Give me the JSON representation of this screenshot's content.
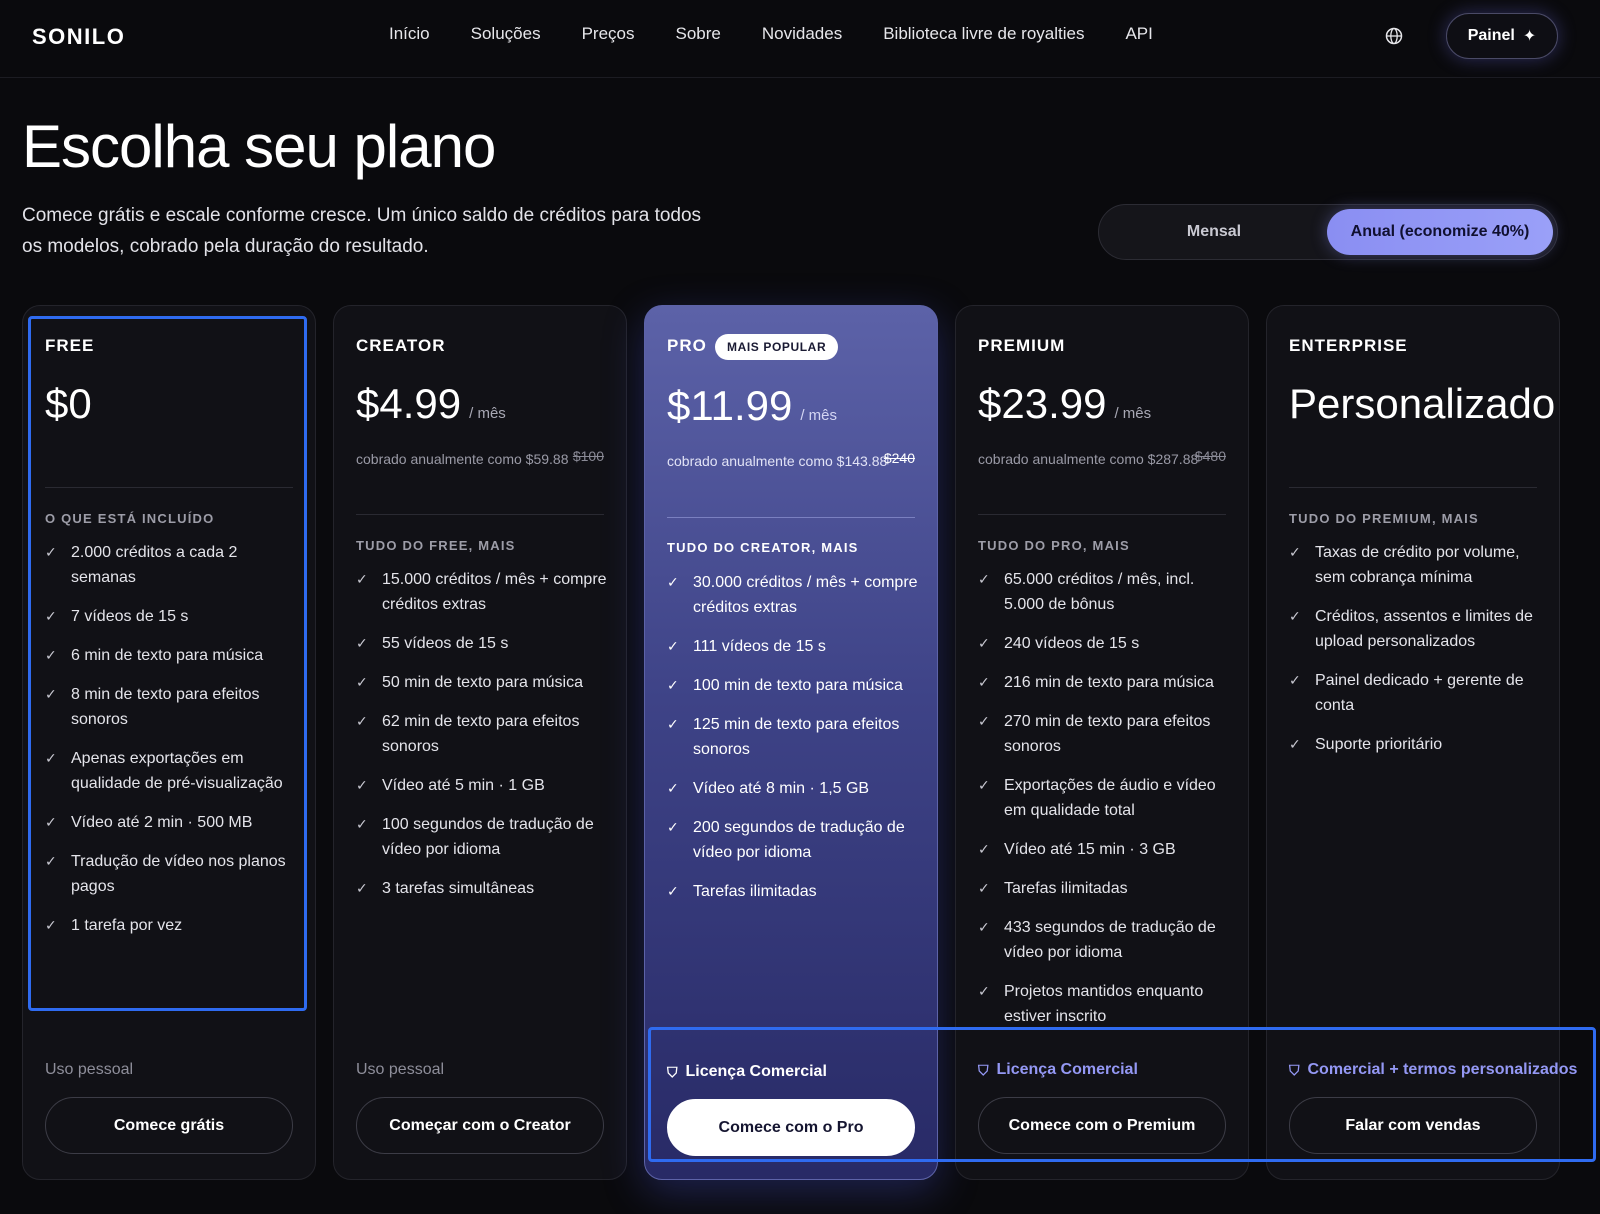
{
  "nav": {
    "logo": "SONILO",
    "links": [
      "Início",
      "Soluções",
      "Preços",
      "Sobre",
      "Novidades",
      "Biblioteca livre de royalties",
      "API"
    ],
    "panel_label": "Painel",
    "panel_icon": "sparkle-icon",
    "language_icon": "globe-icon"
  },
  "header": {
    "title": "Escolha seu plano",
    "subtitle": "Comece grátis e escale conforme cresce. Um único saldo de créditos para todos os modelos, cobrado pela duração do resultado."
  },
  "billing_toggle": {
    "monthly_label": "Mensal",
    "annual_label": "Anual (economize 40%)",
    "selected": "Anual (economize 40%)"
  },
  "plans": [
    {
      "name": "FREE",
      "badge": "",
      "price": "$0",
      "period": "",
      "billed": "",
      "original_price": "",
      "included_heading": "O QUE ESTÁ INCLUÍDO",
      "features": [
        "2.000 créditos a cada 2 semanas",
        "7 vídeos de 15 s",
        "6 min de texto para música",
        "8 min de texto para efeitos sonoros",
        "Apenas exportações em qualidade de pré-visualização",
        "Vídeo até 2 min · 500 MB",
        "Tradução de vídeo nos planos pagos",
        "1 tarefa por vez"
      ],
      "usage": "Uso pessoal",
      "cta": "Comece grátis"
    },
    {
      "name": "CREATOR",
      "badge": "",
      "price": "$4.99",
      "period": "/ mês",
      "billed": "cobrado anualmente como $59.88",
      "original_price": "$100",
      "included_heading": "TUDO DO FREE, MAIS",
      "features": [
        "15.000 créditos / mês + compre créditos extras",
        "55 vídeos de 15 s",
        "50 min de texto para música",
        "62 min de texto para efeitos sonoros",
        "Vídeo até 5 min · 1 GB",
        "100 segundos de tradução de vídeo por idioma",
        "3 tarefas simultâneas"
      ],
      "usage": "Uso pessoal",
      "cta": "Começar com o Creator"
    },
    {
      "name": "PRO",
      "badge": "MAIS POPULAR",
      "price": "$11.99",
      "period": "/ mês",
      "billed": "cobrado anualmente como $143.88",
      "original_price": "$240",
      "included_heading": "TUDO DO CREATOR, MAIS",
      "features": [
        "30.000 créditos / mês + compre créditos extras",
        "111 vídeos de 15 s",
        "100 min de texto para música",
        "125 min de texto para efeitos sonoros",
        "Vídeo até 8 min · 1,5 GB",
        "200 segundos de tradução de vídeo por idioma",
        "Tarefas ilimitadas"
      ],
      "usage": "Licença Comercial",
      "cta": "Comece com o Pro"
    },
    {
      "name": "PREMIUM",
      "badge": "",
      "price": "$23.99",
      "period": "/ mês",
      "billed": "cobrado anualmente como $287.88",
      "original_price": "$480",
      "included_heading": "TUDO DO PRO, MAIS",
      "features": [
        "65.000 créditos / mês, incl. 5.000 de bônus",
        "240 vídeos de 15 s",
        "216 min de texto para música",
        "270 min de texto para efeitos sonoros",
        "Exportações de áudio e vídeo em qualidade total",
        "Vídeo até 15 min · 3 GB",
        "Tarefas ilimitadas",
        "433 segundos de tradução de vídeo por idioma",
        "Projetos mantidos enquanto estiver inscrito"
      ],
      "usage": "Licença Comercial",
      "cta": "Comece com o Premium"
    },
    {
      "name": "ENTERPRISE",
      "badge": "",
      "price": "Personalizado",
      "period": "",
      "billed": "",
      "original_price": "",
      "included_heading": "TUDO DO PREMIUM, MAIS",
      "features": [
        "Taxas de crédito por volume, sem cobrança mínima",
        "Créditos, assentos e limites de upload personalizados",
        "Painel dedicado + gerente de conta",
        "Suporte prioritário"
      ],
      "usage": "Comercial + termos personalizados",
      "cta": "Falar com vendas"
    }
  ],
  "colors": {
    "background": "#0a0a0d",
    "accent": "#8a8ef2",
    "pro_card": "#3e4387",
    "license_text": "#9498f4",
    "highlight_outline": "#2f6bf0"
  }
}
